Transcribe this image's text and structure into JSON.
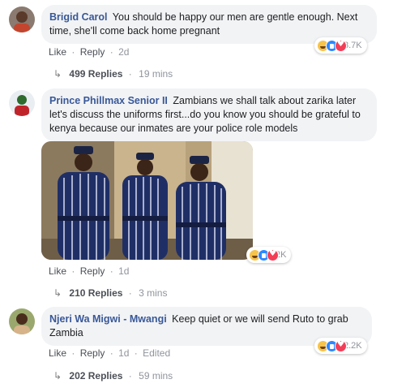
{
  "comments": [
    {
      "author": "Brigid Carol",
      "text": "You should be happy our men are gentle enough. Next time, she'll come back home pregnant",
      "actions": {
        "like": "Like",
        "reply": "Reply",
        "time": "2d",
        "edited": ""
      },
      "reactions": {
        "types": [
          "haha-icon",
          "like-icon",
          "love-icon"
        ],
        "count": "3.7K"
      },
      "replies": {
        "label": "499 Replies",
        "time": "19 mins"
      }
    },
    {
      "author": "Prince Phillmax Senior II",
      "text": "Zambians we shall talk about zarika later let's discuss the uniforms first...do you know you should be grateful to kenya because our inmates are your police role models",
      "actions": {
        "like": "Like",
        "reply": "Reply",
        "time": "1d",
        "edited": ""
      },
      "reactions": {
        "types": [
          "haha-icon",
          "like-icon",
          "love-icon"
        ],
        "count": "2K"
      },
      "replies": {
        "label": "210 Replies",
        "time": "3 mins"
      }
    },
    {
      "author": "Njeri Wa Migwi - Mwangi",
      "text": "Keep quiet or we will send Ruto to grab Zambia",
      "actions": {
        "like": "Like",
        "reply": "Reply",
        "time": "1d",
        "edited": "Edited"
      },
      "reactions": {
        "types": [
          "haha-icon",
          "like-icon",
          "love-icon"
        ],
        "count": "2.2K"
      },
      "replies": {
        "label": "202 Replies",
        "time": "59 mins"
      }
    }
  ],
  "colors": {
    "name": "#385898",
    "bubble": "#f2f3f5",
    "meta": "#90949c",
    "link": "#4b4f56"
  },
  "separator": "·",
  "reply_arrow": "↳"
}
